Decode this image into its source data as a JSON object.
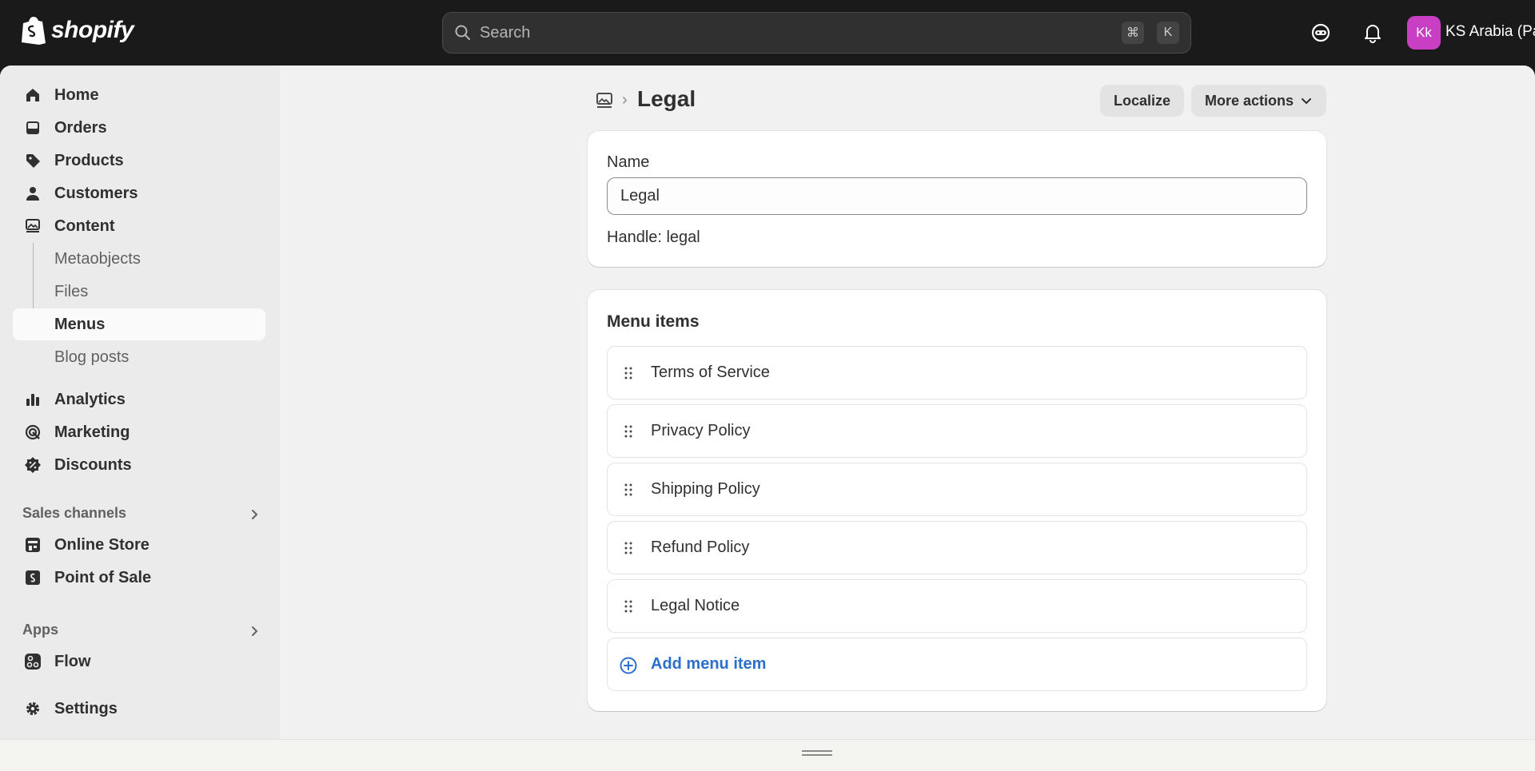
{
  "topbar": {
    "logo_text": "shopify",
    "search_placeholder": "Search",
    "shortcut_cmd": "⌘",
    "shortcut_key": "K",
    "avatar_initials": "Kk",
    "store_name": "KS Arabia (Pa"
  },
  "sidebar": {
    "items": [
      {
        "label": "Home"
      },
      {
        "label": "Orders"
      },
      {
        "label": "Products"
      },
      {
        "label": "Customers"
      },
      {
        "label": "Content"
      },
      {
        "label": "Metaobjects"
      },
      {
        "label": "Files"
      },
      {
        "label": "Menus"
      },
      {
        "label": "Blog posts"
      },
      {
        "label": "Analytics"
      },
      {
        "label": "Marketing"
      },
      {
        "label": "Discounts"
      }
    ],
    "sales_channels_label": "Sales channels",
    "sales_channels": [
      {
        "label": "Online Store"
      },
      {
        "label": "Point of Sale"
      }
    ],
    "apps_label": "Apps",
    "apps": [
      {
        "label": "Flow"
      }
    ],
    "settings_label": "Settings"
  },
  "page": {
    "title": "Legal",
    "breadcrumb_separator": "›",
    "localize_label": "Localize",
    "more_actions_label": "More actions"
  },
  "name_card": {
    "name_label": "Name",
    "name_value": "Legal",
    "handle_text": "Handle: legal"
  },
  "menu_card": {
    "title": "Menu items",
    "items": [
      {
        "label": "Terms of Service"
      },
      {
        "label": "Privacy Policy"
      },
      {
        "label": "Shipping Policy"
      },
      {
        "label": "Refund Policy"
      },
      {
        "label": "Legal Notice"
      }
    ],
    "add_label": "Add menu item"
  },
  "colors": {
    "topbar_bg": "#1a1a1a",
    "sidebar_bg": "#ebebeb",
    "content_bg": "#f1f1f1",
    "accent_link": "#2c6ecb",
    "avatar_bg": "#c83fc3"
  }
}
